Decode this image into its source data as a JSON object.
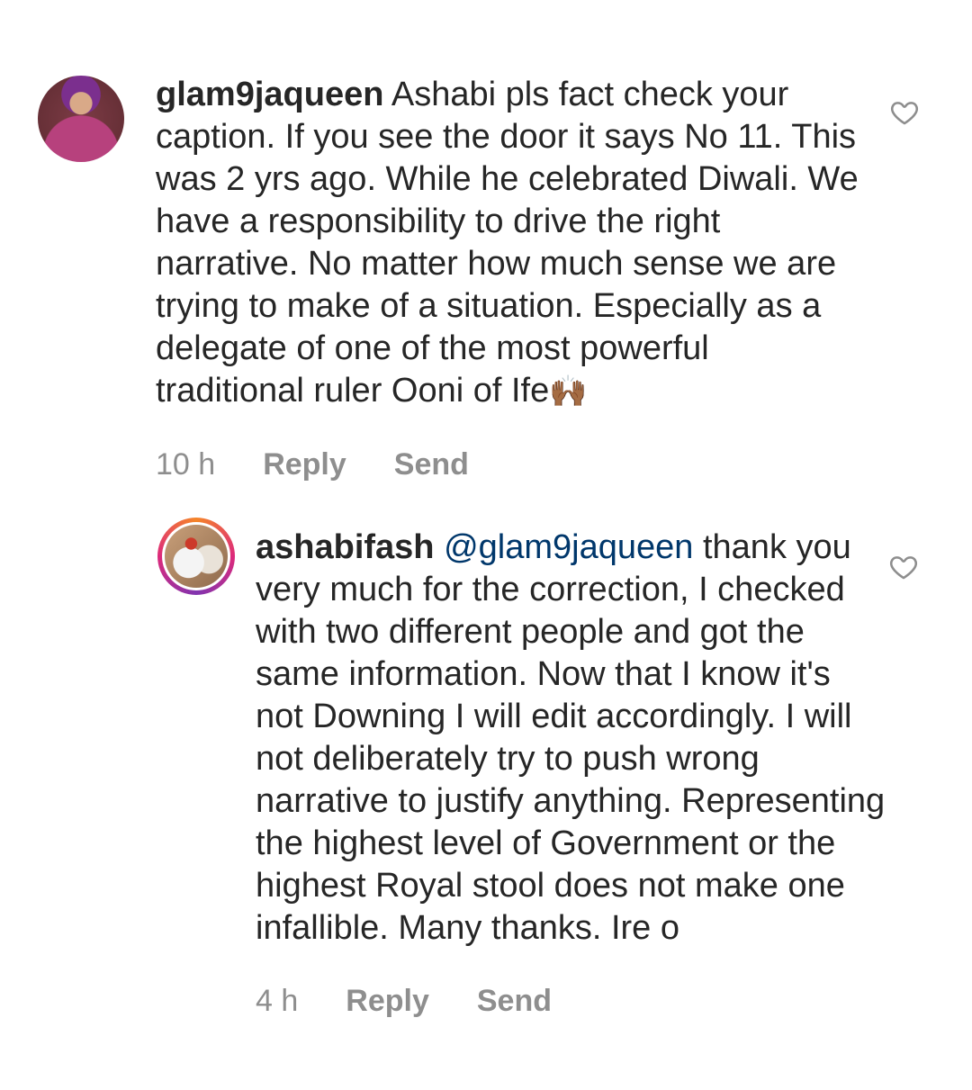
{
  "comments": [
    {
      "username": "glam9jaqueen",
      "mention": "",
      "text": "Ashabi pls fact check your caption. If you see the door it says No 11. This was 2 yrs ago. While he celebrated Diwali. We have a responsibility to drive the right narrative.  No matter how much sense we are trying to make of a situation. Especially as a delegate of one of the most powerful traditional ruler Ooni of Ife",
      "emoji": "🙌🏾",
      "time": "10 h",
      "reply_label": "Reply",
      "send_label": "Send",
      "avatar": "profile-photo"
    },
    {
      "username": "ashabifash",
      "mention": "@glam9jaqueen",
      "text": "thank you very much for the correction, I checked with two different people and got the same information. Now that I know it's not Downing I will edit accordingly. I will not deliberately try to push wrong narrative to justify anything. Representing the highest level of Government or the highest Royal stool does not make one infallible. Many thanks. Ire o",
      "emoji": "",
      "time": "4 h",
      "reply_label": "Reply",
      "send_label": "Send",
      "avatar": "profile-photo-with-story-ring"
    }
  ],
  "icons": {
    "like": "heart-outline-icon"
  },
  "colors": {
    "text": "#262626",
    "meta": "#8e8e8e",
    "mention": "#00376b"
  }
}
